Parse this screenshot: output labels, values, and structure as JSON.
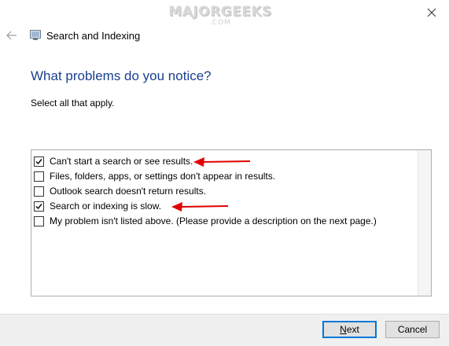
{
  "watermark": {
    "brand": "MAJORGEEKS",
    "domain": ".COM"
  },
  "window": {
    "title": "Search and Indexing"
  },
  "page": {
    "heading": "What problems do you notice?",
    "instruction": "Select all that apply."
  },
  "options": [
    {
      "label": "Can't start a search or see results.",
      "checked": true
    },
    {
      "label": "Files, folders, apps, or settings don't appear in results.",
      "checked": false
    },
    {
      "label": "Outlook search doesn't return results.",
      "checked": false
    },
    {
      "label": "Search or indexing is slow.",
      "checked": true
    },
    {
      "label": "My problem isn't listed above. (Please provide a description on the next page.)",
      "checked": false
    }
  ],
  "buttons": {
    "next": {
      "mnemonic": "N",
      "rest": "ext"
    },
    "cancel": "Cancel"
  },
  "colors": {
    "heading": "#1a3f8f",
    "arrow": "#e00000",
    "primary_border": "#0078d7"
  }
}
